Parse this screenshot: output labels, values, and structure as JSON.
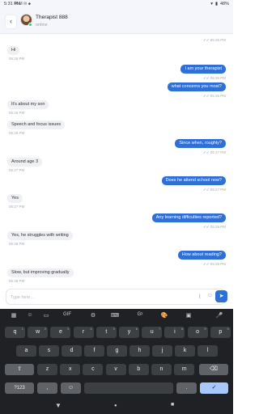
{
  "status_bar": {
    "time": "5:31 PM",
    "left_icons": "M M ✉ ⬥",
    "battery": "48%"
  },
  "header": {
    "name": "Therapist 888",
    "status": "online"
  },
  "messages": [
    {
      "dir": "out",
      "text": "",
      "time": "05:26 PM"
    },
    {
      "dir": "in",
      "text": "Hi",
      "time": "05:26 PM"
    },
    {
      "dir": "out",
      "text": "I am your therapist",
      "time": "05:26 PM"
    },
    {
      "dir": "out",
      "text": "what concerns you most?",
      "time": "05:26 PM"
    },
    {
      "dir": "in",
      "text": "It's about my son",
      "time": "05:26 PM"
    },
    {
      "dir": "in",
      "text": "Speech and focus issues",
      "time": "05:26 PM"
    },
    {
      "dir": "out",
      "text": "Since when, roughly?",
      "time": "05:27 PM"
    },
    {
      "dir": "in",
      "text": "Around age 3",
      "time": "05:27 PM"
    },
    {
      "dir": "out",
      "text": "Does he attend school now?",
      "time": "05:27 PM"
    },
    {
      "dir": "in",
      "text": "Yes",
      "time": "05:27 PM"
    },
    {
      "dir": "out",
      "text": "Any learning difficulties reported?",
      "time": "05:28 PM"
    },
    {
      "dir": "in",
      "text": "Yes, he struggles with writing",
      "time": "05:28 PM"
    },
    {
      "dir": "out",
      "text": "How about reading?",
      "time": "05:28 PM"
    },
    {
      "dir": "in",
      "text": "Slow, but improving gradually",
      "time": "05:28 PM"
    }
  ],
  "composer": {
    "placeholder": "Type here..."
  },
  "keyboard": {
    "toolbar": [
      "▦",
      "☺",
      "▭",
      "GIF",
      "⚙",
      "Gᵡ",
      "🎨",
      "▣",
      "🎤"
    ],
    "row1": [
      "q",
      "w",
      "e",
      "r",
      "t",
      "y",
      "u",
      "i",
      "o",
      "p"
    ],
    "row1_sup": [
      "1",
      "2",
      "3",
      "4",
      "5",
      "6",
      "7",
      "8",
      "9",
      "0"
    ],
    "row2": [
      "a",
      "s",
      "d",
      "f",
      "g",
      "h",
      "j",
      "k",
      "l"
    ],
    "row3": [
      "z",
      "x",
      "c",
      "v",
      "b",
      "n",
      "m"
    ],
    "shift": "⇧",
    "backspace": "⌫",
    "symbols": "?123",
    "comma": ",",
    "emoji": "☺",
    "period": ".",
    "enter": "✓"
  },
  "nav": {
    "back": "▼",
    "home": "●",
    "recents": "■"
  }
}
